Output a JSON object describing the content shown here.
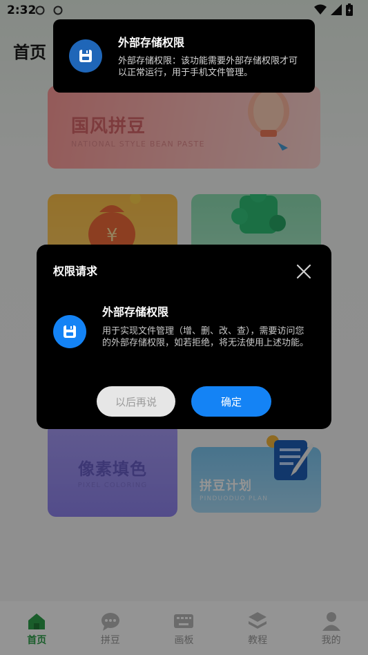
{
  "status_bar": {
    "time": "2:32"
  },
  "page": {
    "title": "首页"
  },
  "cards": {
    "guofeng": {
      "title": "国风拼豆",
      "subtitle": "NATIONAL STYLE BEAN PASTE"
    },
    "pixel": {
      "title": "像素填色",
      "subtitle": "PIXEL COLORING"
    },
    "plan": {
      "title": "拼豆计划",
      "subtitle": "PINDUODUO PLAN"
    }
  },
  "bottom_nav": {
    "items": [
      {
        "label": "首页",
        "icon": "home-icon",
        "active": true
      },
      {
        "label": "拼豆",
        "icon": "chat-icon",
        "active": false
      },
      {
        "label": "画板",
        "icon": "keyboard-icon",
        "active": false
      },
      {
        "label": "教程",
        "icon": "layers-icon",
        "active": false
      },
      {
        "label": "我的",
        "icon": "user-icon",
        "active": false
      }
    ]
  },
  "toast": {
    "title": "外部存储权限",
    "body": "外部存储权限：该功能需要外部存储权限才可以正常运行，用于手机文件管理。",
    "icon": "storage-icon"
  },
  "dialog": {
    "title": "权限请求",
    "permission_title": "外部存储权限",
    "permission_desc": "用于实现文件管理（增、删、改、查），需要访问您的外部存储权限，如若拒绝，将无法使用上述功能。",
    "later_label": "以后再说",
    "confirm_label": "确定",
    "icon": "storage-icon"
  },
  "colors": {
    "primary_blue": "#1483f5",
    "nav_active": "#2ea04a",
    "dialog_bg": "#000000"
  }
}
